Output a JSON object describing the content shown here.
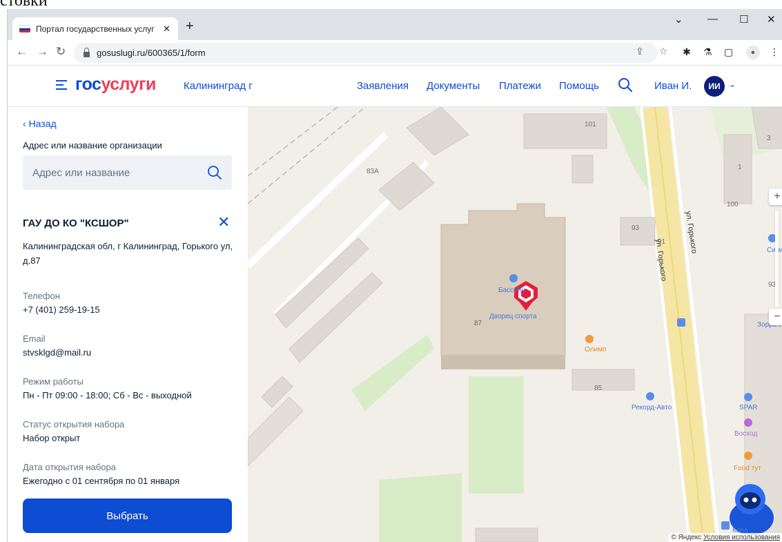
{
  "top_cut_text": "стовки",
  "browser": {
    "tab_title": "Портал государственных услуг Р",
    "url": "gosuslugi.ru/600365/1/form"
  },
  "header": {
    "logo_part1": "гос",
    "logo_part2": "услуги",
    "city": "Калининград г",
    "nav": [
      "Заявления",
      "Документы",
      "Платежи",
      "Помощь"
    ],
    "user_name": "Иван И.",
    "user_initials": "ИИ"
  },
  "panel": {
    "back_label": "Назад",
    "address_label": "Адрес или название организации",
    "search_placeholder": "Адрес или название",
    "org_name": "ГАУ ДО КО \"КСШОР\"",
    "org_address": "Калининградская обл, г Калининград, Горького ул, д.87",
    "phone_label": "Телефон",
    "phone_value": "+7 (401) 259-19-15",
    "email_label": "Email",
    "email_value": "stvsklgd@mail.ru",
    "hours_label": "Режим работы",
    "hours_value": "Пн - Пт 09:00 - 18:00; Сб - Вс - выходной",
    "status_label": "Статус открытия набора",
    "status_value": "Набор открыт",
    "date_label": "Дата открытия набора",
    "date_value": "Ежегодно с 01 сентября по 01 января",
    "choose_label": "Выбрать"
  },
  "map": {
    "buildings": [
      "101",
      "3",
      "83А",
      "1",
      "100",
      "93",
      "91",
      "87",
      "85",
      "93"
    ],
    "street": "ул. Горького",
    "pois": {
      "pool": "Бассейн",
      "palace": "Дворец спорта",
      "olimp": "Олимп",
      "rekord": "Рекорд-Авто",
      "sigma": "Сигма-Авто",
      "zorro": "Зорро Па",
      "spar": "SPAR",
      "voshod": "Восход",
      "food": "Food тут",
      "kera": "Кера"
    },
    "copyright_left": "© Яндекс",
    "copyright_link": "Условия использования"
  },
  "colors": {
    "brand_blue": "#0d4cd3",
    "brand_red": "#ee3f58",
    "marker": "#e31e3c"
  }
}
